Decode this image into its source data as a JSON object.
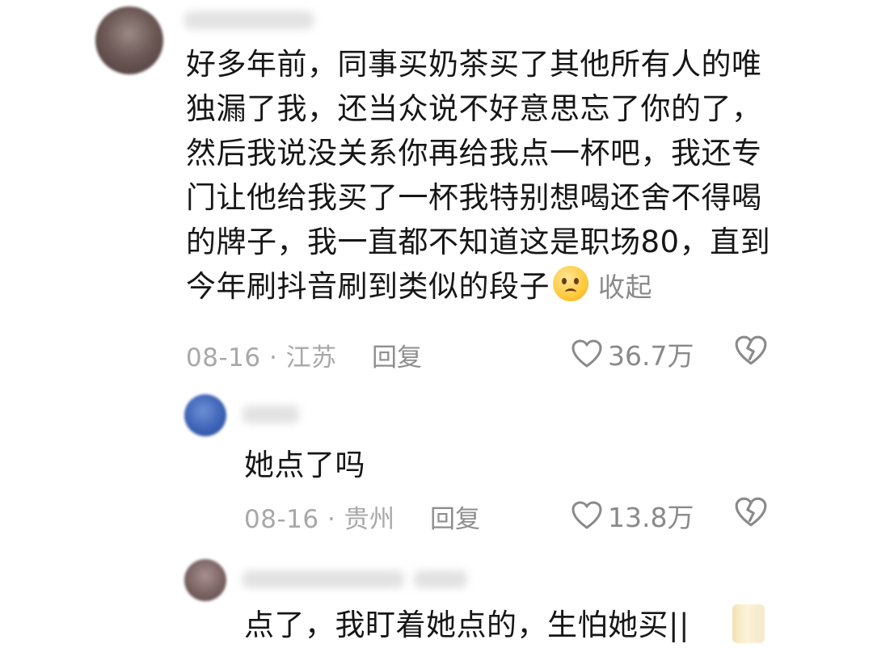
{
  "main_comment": {
    "lines": [
      "好多年前，同事买奶茶买了其他所有人的唯",
      "独漏了我，还当众说不好意思忘了你的了，",
      "然后我说没关系你再给我点一杯吧，我还专",
      "门让他给我买了一杯我特别想喝还舍不得喝",
      "的牌子，我一直都不知道这是职场80，直到",
      "今年刷抖音刷到类似的段子"
    ],
    "emoji_icon": "awkward-face-emoji",
    "collapse_label": "收起",
    "date": "08-16",
    "location": "江苏",
    "reply_label": "回复",
    "like_count": "36.7万"
  },
  "replies": [
    {
      "text": "她点了吗",
      "date": "08-16",
      "location": "贵州",
      "reply_label": "回复",
      "like_count": "13.8万"
    },
    {
      "text": "点了，我盯着她点的，生怕她买||"
    }
  ],
  "icons": {
    "like": "heart-outline-icon",
    "dislike": "broken-heart-icon"
  },
  "colors": {
    "text": "#161616",
    "meta": "#a8a8a8",
    "icon": "#8a8a8a"
  }
}
